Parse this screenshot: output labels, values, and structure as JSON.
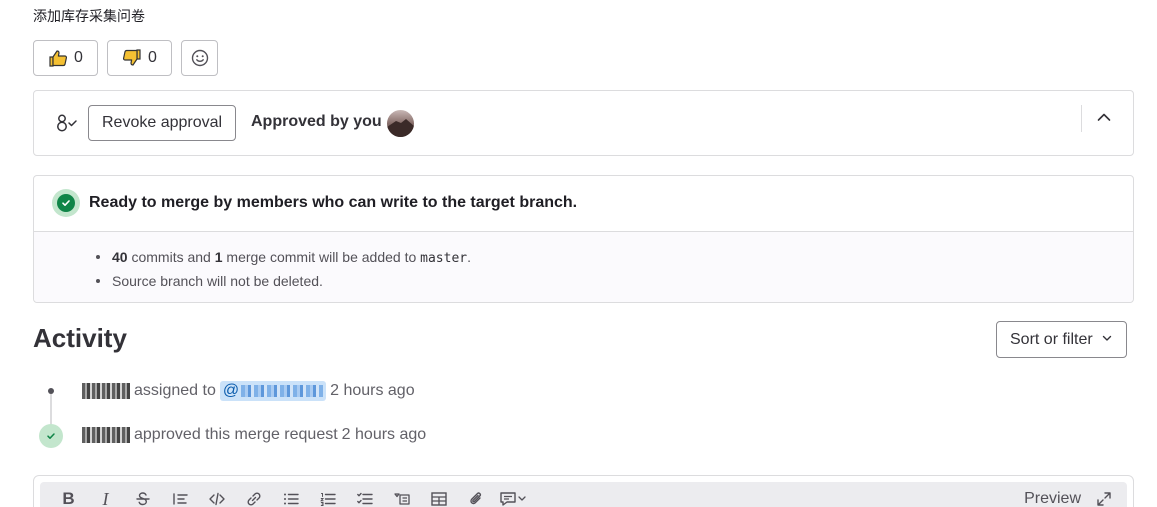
{
  "description": "添加库存采集问卷",
  "awards": {
    "thumbsup_count": "0",
    "thumbsdown_count": "0"
  },
  "approval": {
    "revoke_label": "Revoke approval",
    "approved_label": "Approved by you"
  },
  "merge": {
    "status_text": "Ready to merge by members who can write to the target branch.",
    "commits_count": "40",
    "commits_text": " commits and ",
    "merge_commit_count": "1",
    "merge_commit_text": " merge commit will be added to ",
    "target_branch": "master",
    "period": ".",
    "source_branch_note": "Source branch will not be deleted."
  },
  "activity": {
    "title": "Activity",
    "sort_label": "Sort or filter",
    "notes": [
      {
        "action": "assigned to",
        "mention_prefix": "@",
        "time": "2 hours ago"
      },
      {
        "action": "approved this merge request",
        "time": "2 hours ago"
      }
    ]
  },
  "editor": {
    "preview_label": "Preview",
    "bold_glyph": "B",
    "italic_glyph": "I"
  },
  "colors": {
    "success": "#108548",
    "success_light": "#c3e6cd",
    "mention_bg": "#cbe2f9",
    "border": "#dcdcde"
  }
}
